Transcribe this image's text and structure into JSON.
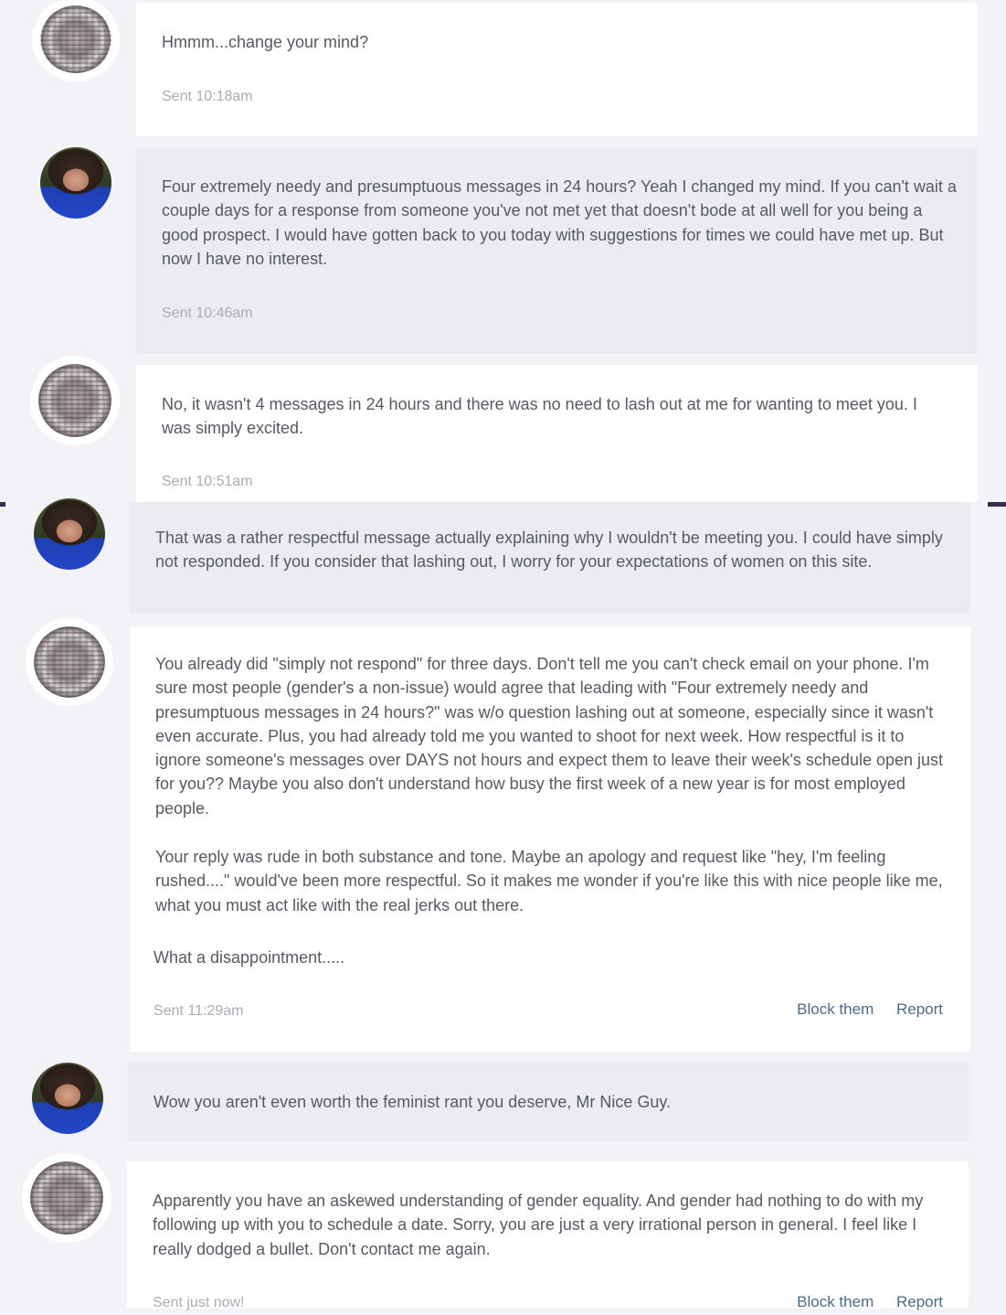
{
  "messages": [
    {
      "text": "Hmmm...change your mind?",
      "sent": "Sent 10:18am"
    },
    {
      "text": "Four extremely needy and presumptuous messages in 24 hours? Yeah I changed my mind. If you can't wait a couple days for a response from someone you've not met yet that doesn't bode at all well for you being a good prospect. I would have gotten back to you today with suggestions for times we could have met up. But now I have no interest.",
      "sent": "Sent 10:46am"
    },
    {
      "text": "No, it wasn't 4 messages in 24 hours and there was no need to lash out at me for wanting to meet you. I was simply excited.",
      "sent": "Sent 10:51am"
    },
    {
      "text": "That was a rather respectful message actually explaining why I wouldn't be meeting you. I could have simply not responded. If you consider that lashing out, I worry for your expectations of women on this site."
    },
    {
      "para1": "You already did \"simply not respond\" for three days. Don't tell me you can't check email on your phone. I'm sure most people (gender's a non-issue) would agree that leading with \"Four extremely needy and presumptuous messages in 24 hours?\" was w/o question lashing out at someone, especially since it wasn't even accurate. Plus, you had already told me you wanted to shoot for next week. How respectful is it to ignore someone's messages over DAYS not hours and expect them to leave their week's schedule open just for you?? Maybe you also don't understand how busy the first week of a new year is for most employed people.",
      "para2": "Your reply was rude in both substance and tone. Maybe an apology and request like \"hey, I'm feeling rushed....\" would've been more respectful. So it makes me wonder if you're like this with nice people like me, what you must act like with the real jerks out there.",
      "para3": "What a disappointment.....",
      "sent": "Sent 11:29am",
      "block": "Block them",
      "report": "Report"
    },
    {
      "text": "Wow you aren't even worth the feminist rant you deserve, Mr Nice Guy."
    },
    {
      "text": "Apparently you have an askewed understanding of gender equality. And gender had nothing to do with my following up with you to schedule a date. Sorry, you are just a very irrational person in general. I feel like I really dodged a bullet. Don't contact me again.",
      "sent": "Sent just now!",
      "block": "Block them",
      "report": "Report"
    }
  ],
  "colors": {
    "incoming_bg": "#ffffff",
    "outgoing_bg": "#ebebf1",
    "page_bg": "#f2f2f7",
    "link": "#4d6a87",
    "meta": "#a9adb5"
  }
}
